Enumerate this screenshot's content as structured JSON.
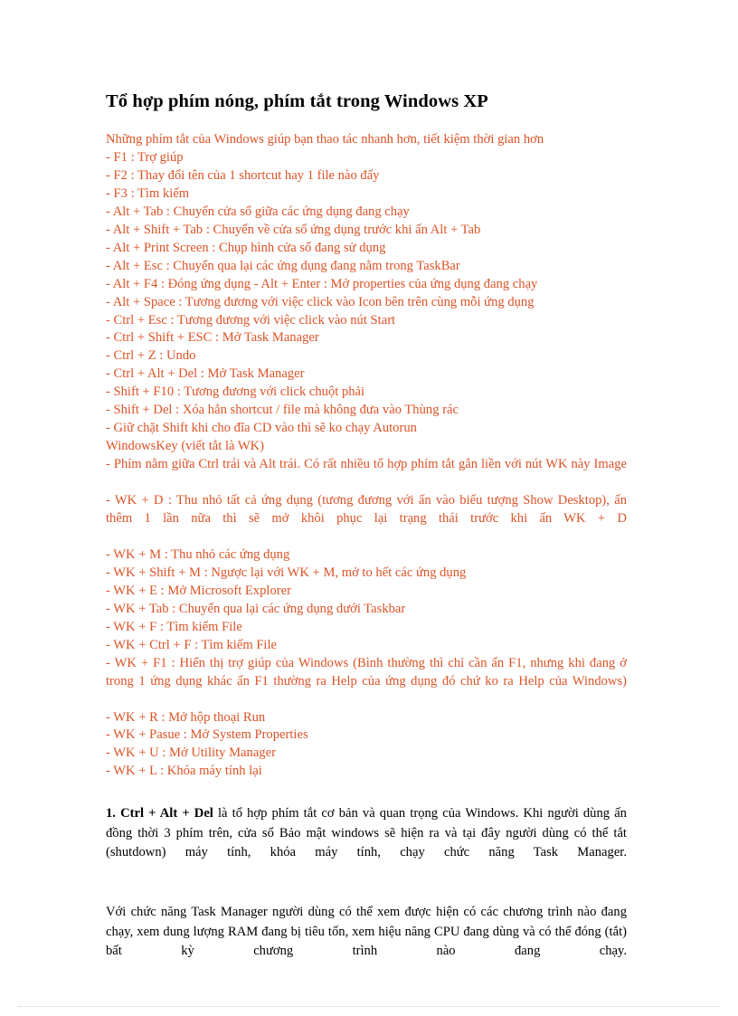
{
  "document": {
    "title": "Tổ hợp phím nóng, phím tắt trong Windows XP",
    "intro": "Những phím tắt của Windows giúp bạn thao tác nhanh hơn, tiết kiệm thời gian hơn",
    "accent_color": "#DB5327",
    "text_color": "#000000",
    "background_color": "#FFFFFF",
    "shortcut_lines": [
      "- F1 : Trợ giúp",
      "- F2 : Thay đổi tên của 1 shortcut hay 1 file nào đấy",
      "- F3 : Tìm kiếm",
      "- Alt + Tab : Chuyển cửa sổ giữa các ứng dụng đang chạy",
      "- Alt + Shift + Tab : Chuyển về cửa sổ ứng dụng trước khi ấn Alt + Tab",
      "- Alt + Print Screen : Chụp hình cửa sổ đang sử dụng",
      "- Alt + Esc : Chuyển qua lại các ứng dụng đang nằm trong TaskBar",
      "- Alt + F4 : Đóng ứng dụng - Alt + Enter : Mở properties của ứng dụng đang chạy",
      "- Alt + Space : Tương đương với việc click vào Icon bên trên cùng mỗi ứng dụng",
      "- Ctrl + Esc : Tương đương với việc click vào nút Start",
      "- Ctrl + Shift + ESC : Mở Task Manager",
      "- Ctrl + Z : Undo",
      "- Ctrl + Alt + Del : Mở Task Manager",
      "- Shift + F10 : Tương đương với click chuột phải",
      "- Shift + Del : Xóa hẳn shortcut / file mà không đưa vào Thùng rác",
      "- Giữ chặt Shift khi cho đĩa CD vào thì sẽ ko chạy Autorun",
      "WindowsKey (viết tắt là WK)",
      "- Phím nằm giữa Ctrl trái và Alt trái. Có rất nhiều tổ hợp phím tắt gắn liền với nút WK này Image",
      "- WK + D : Thu nhỏ tất cả ứng dụng (tương đương với ấn vào biểu tượng Show Desktop), ấn thêm 1 lần nữa thì sẽ mở khôi phục lại trạng thái trước khi ấn WK + D",
      "- WK + M : Thu nhỏ các ứng dụng",
      "- WK + Shift + M : Ngược lại với WK + M, mở to hết các ứng dụng",
      "- WK + E : Mở Microsoft Explorer",
      "- WK + Tab : Chuyển qua lại các ứng dụng dưới Taskbar",
      "- WK + F : Tìm kiếm File",
      "- WK + Ctrl + F : Tìm kiếm File",
      "- WK + F1 : Hiển thị trợ giúp của Windows (Bình thường thì chỉ cần ấn F1, nhưng khi đang ở trong 1 ứng dụng khác ấn F1 thường ra Help của ứng dụng đó chứ ko ra Help của Windows)",
      "- WK + R : Mở hộp thoại Run",
      "- WK + Pasue : Mở System Properties",
      "- WK + U : Mở Utility Manager",
      "- WK + L : Khóa máy tính lại"
    ],
    "paragraph_1": {
      "bold_lead": "1. Ctrl + Alt + Del",
      "rest": " là tổ hợp phím tắt cơ bản và quan trọng của Windows. Khi người dùng ấn đồng thời 3 phím trên, cửa sổ Bảo mật windows sẽ hiện ra và tại đây người dùng có thể tắt (shutdown) máy tính, khóa máy tính, chạy chức năng Task Manager."
    },
    "paragraph_2": "Với chức năng Task Manager người dùng có thể xem được hiện có các chương trình nào đang chạy, xem dung lượng RAM đang bị tiêu tốn, xem hiệu năng CPU đang dùng và có thể đóng (tắt) bất kỳ chương trình nào đang chạy."
  }
}
